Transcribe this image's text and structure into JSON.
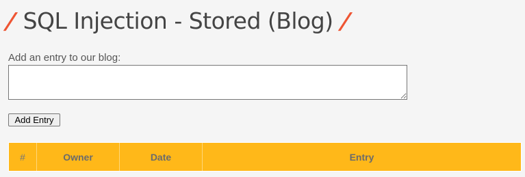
{
  "header": {
    "slash_left": "/",
    "title": "SQL Injection - Stored (Blog)",
    "slash_right": "/",
    "accent_color": "#ee5533"
  },
  "form": {
    "prompt": "Add an entry to our blog:",
    "entry_value": "",
    "add_button_label": "Add Entry"
  },
  "table": {
    "header_color": "#ffb819",
    "columns": [
      "#",
      "Owner",
      "Date",
      "Entry"
    ]
  }
}
